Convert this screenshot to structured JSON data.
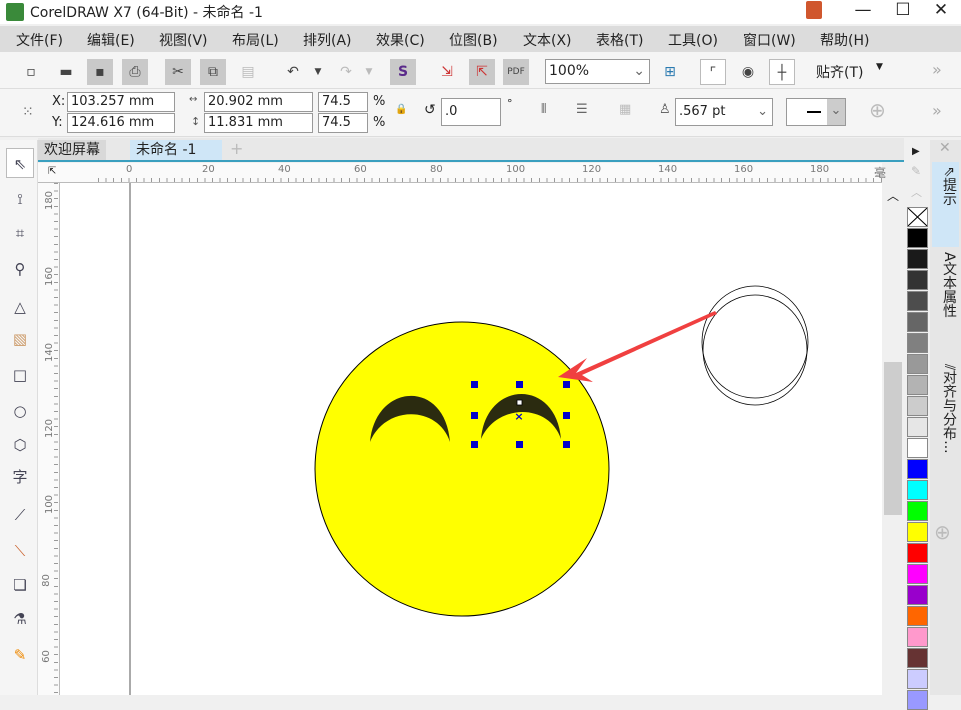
{
  "window": {
    "title": "CorelDRAW X7 (64-Bit) - 未命名 -1",
    "minimize": "—",
    "maximize": "☐",
    "close": "✕"
  },
  "menu": [
    "文件(F)",
    "编辑(E)",
    "视图(V)",
    "布局(L)",
    "排列(A)",
    "效果(C)",
    "位图(B)",
    "文本(X)",
    "表格(T)",
    "工具(O)",
    "窗口(W)",
    "帮助(H)"
  ],
  "standard_toolbar": {
    "zoom_value": "100%",
    "snap_label": "贴齐(T)",
    "more": "»"
  },
  "property_bar": {
    "x_label": "X:",
    "x_value": "103.257 mm",
    "y_label": "Y:",
    "y_value": "124.616 mm",
    "width_value": "20.902 mm",
    "height_value": "11.831 mm",
    "scale_x": "74.5",
    "scale_y": "74.5",
    "percent": "%",
    "rotation": ".0",
    "degree": "°",
    "outline_width": ".567 pt",
    "more": "»"
  },
  "tabs": [
    {
      "label": "欢迎屏幕",
      "active": false
    },
    {
      "label": "未命名 -1",
      "active": true
    }
  ],
  "ruler": {
    "unit": "毫米",
    "h_ticks": [
      "0",
      "20",
      "40",
      "60",
      "80",
      "100",
      "120",
      "140",
      "160",
      "180"
    ],
    "v_ticks": [
      "180",
      "160",
      "140",
      "120",
      "100",
      "80",
      "60"
    ]
  },
  "dockers": [
    "提示",
    "文本属性",
    "对齐与分布..."
  ],
  "palette": [
    "none",
    "#000000",
    "#1a1a1a",
    "#333333",
    "#4d4d4d",
    "#666666",
    "#808080",
    "#999999",
    "#b3b3b3",
    "#cccccc",
    "#e6e6e6",
    "#ffffff",
    "#0000ff",
    "#00ffff",
    "#00ff00",
    "#ffff00",
    "#ff0000",
    "#ff00ff",
    "#9900cc",
    "#ff6600",
    "#ff99cc",
    "#663333",
    "#ccccff",
    "#9999ff"
  ],
  "drawing": {
    "face_fill": "#ffff00",
    "eye_fill": "#2b2b10",
    "arrow_color": "#f04040",
    "handle_color": "#0000cc"
  }
}
